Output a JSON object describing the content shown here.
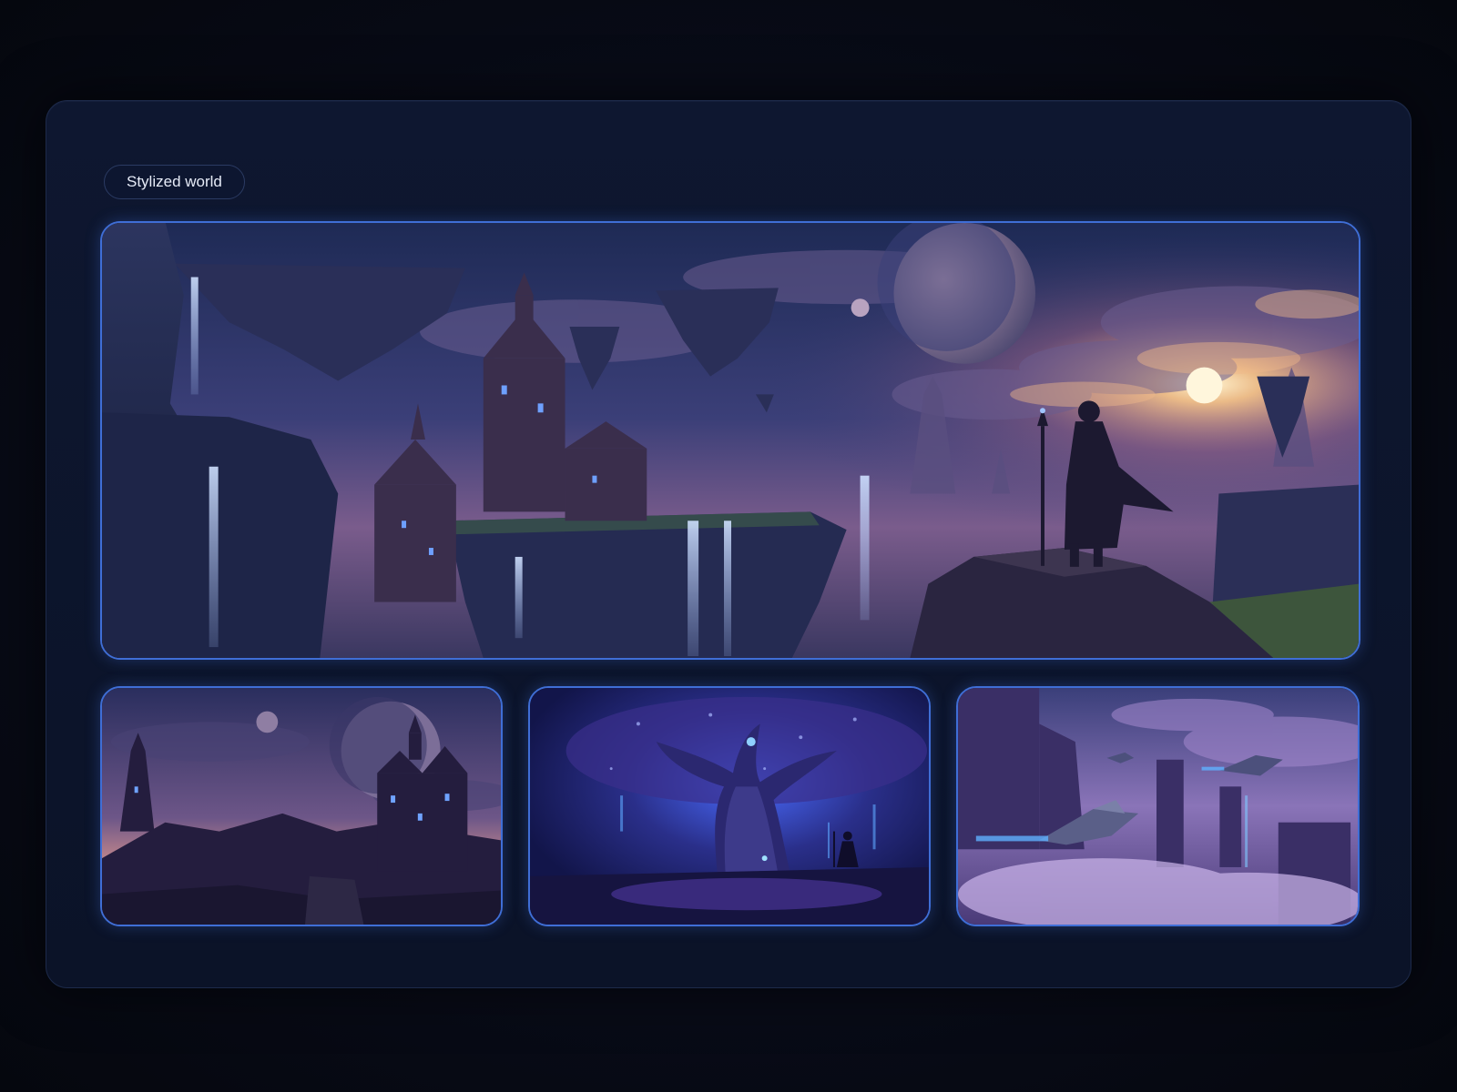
{
  "section": {
    "label": "Stylized world"
  },
  "colors": {
    "accent_border": "#3f6ed6",
    "panel_bg": "#0e1730",
    "page_bg": "#080b17"
  },
  "images": [
    {
      "id": "hero",
      "scene": "floating-islands-sunset-wanderer"
    },
    {
      "id": "thumb-1",
      "scene": "twilight-castle-twin-moons"
    },
    {
      "id": "thumb-2",
      "scene": "glowing-world-tree"
    },
    {
      "id": "thumb-3",
      "scene": "airships-over-cloud-spires"
    }
  ]
}
